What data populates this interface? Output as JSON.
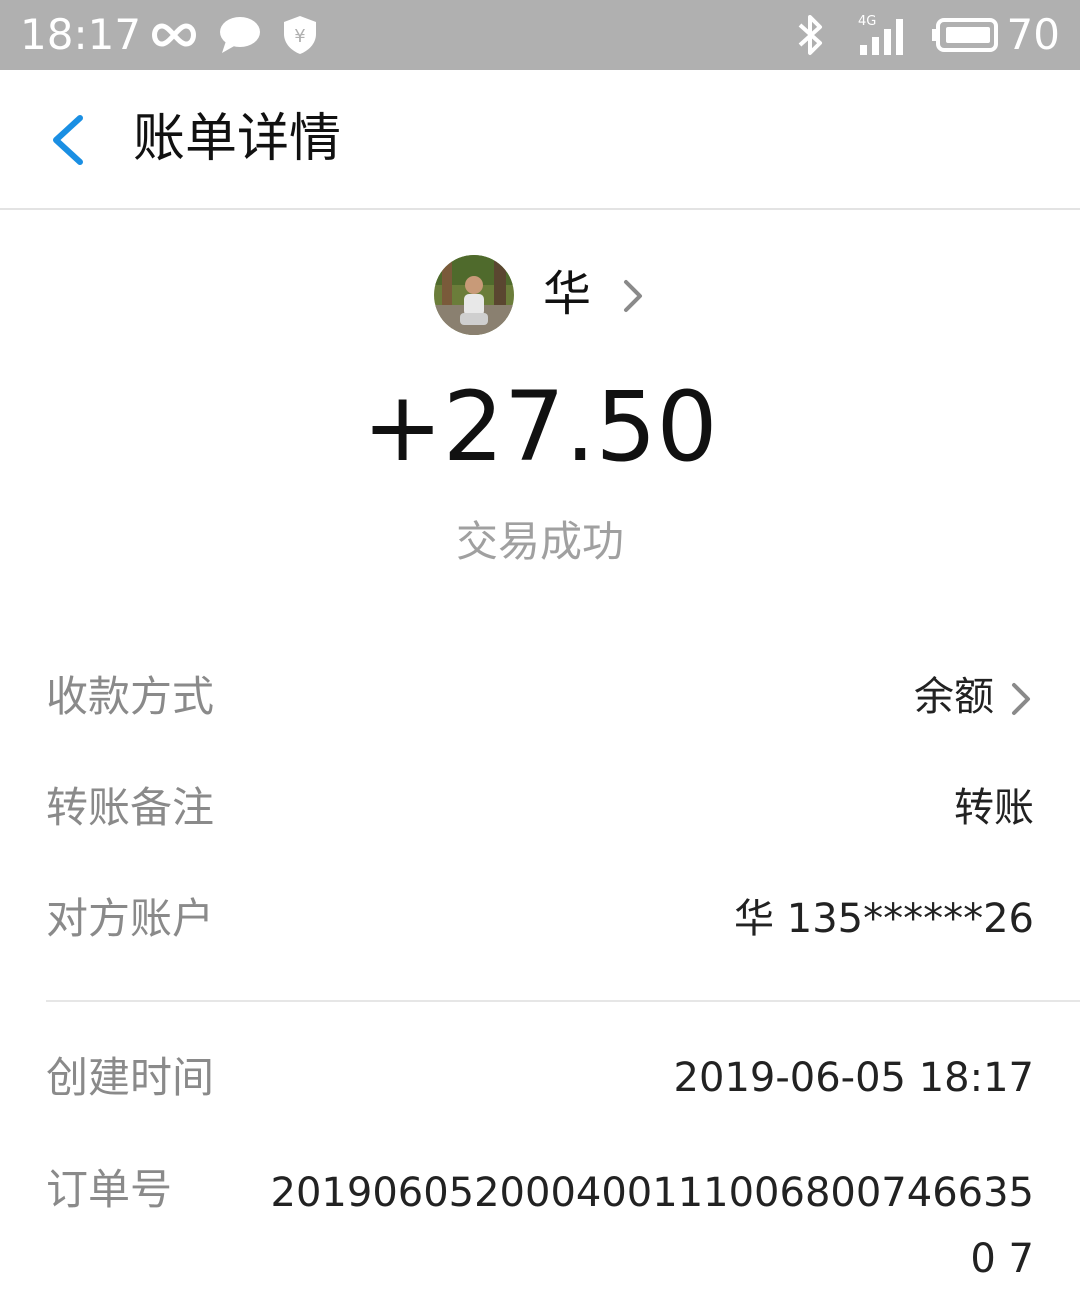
{
  "status_bar": {
    "time": "18:17",
    "icons": [
      "infinity-icon",
      "chat-icon",
      "shield-yuan-icon",
      "bluetooth-icon",
      "signal-4g-icon",
      "battery-icon"
    ],
    "network_label": "4G",
    "battery_level": "70"
  },
  "header": {
    "title": "账单详情",
    "back_icon": "chevron-left-icon",
    "accent_color": "#1a8fe3"
  },
  "party": {
    "name": "华"
  },
  "transaction": {
    "amount": "+27.50",
    "status": "交易成功"
  },
  "details": {
    "payment_method_label": "收款方式",
    "payment_method_value": "余额",
    "remark_label": "转账备注",
    "remark_value": "转账",
    "counterparty_label": "对方账户",
    "counterparty_value": "华 135******26",
    "created_time_label": "创建时间",
    "created_time_value": "2019-06-05 18:17",
    "order_no_label": "订单号",
    "order_no_value": "2019060520004001110068007466350 7"
  }
}
